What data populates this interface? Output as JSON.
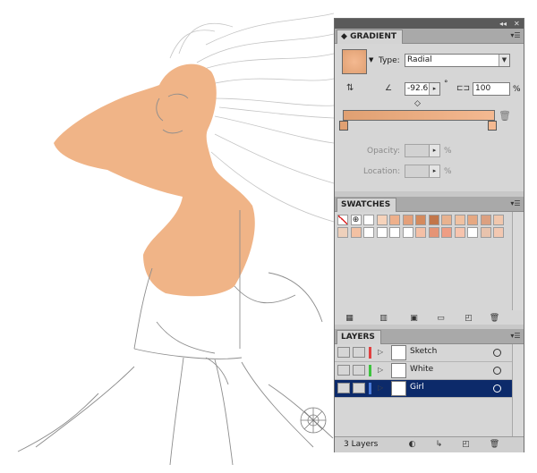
{
  "panel": {
    "collapse_icon": "double-arrow-icon",
    "close_icon": "close-icon"
  },
  "gradient": {
    "tab": "GRADIENT",
    "type_label": "Type:",
    "type_value": "Radial",
    "angle_value": "-92.6",
    "degree_symbol": "°",
    "aspect_value": "100",
    "percent_symbol": "%",
    "start_color": "#e0a072",
    "end_color": "#f4b991",
    "opacity_label": "Opacity:",
    "location_label": "Location:"
  },
  "swatches": {
    "tab": "SWATCHES",
    "row1": [
      "none",
      "registration",
      "#ffffff",
      "#f6d3bb",
      "#eeb08b",
      "#e4a07a",
      "#d48a5d",
      "#c2764a",
      "#e8b28f",
      "#f0c1a1",
      "#e6a882",
      "#dca080",
      "#f1c7ad"
    ],
    "row2": [
      "#eed0bb",
      "#f3c1a3",
      "#ffffff",
      "#ffffff",
      "#ffffff",
      "#ffffff",
      "#f5c0a6",
      "#e59476",
      "#ee9d84",
      "#f7c4ae",
      "#ffffff",
      "#e8c3ad",
      "#f3c8b1"
    ]
  },
  "layers": {
    "tab": "LAYERS",
    "items": [
      {
        "name": "Sketch",
        "color": "#e04040",
        "selected": false
      },
      {
        "name": "White",
        "color": "#3ec33e",
        "selected": false
      },
      {
        "name": "Girl",
        "color": "#4a7ad8",
        "selected": true
      }
    ],
    "count": "3 Layers"
  },
  "colors": {
    "skin": "#f0b487",
    "pencil": "#b9b9b9",
    "selected_row": "#0c2a6a"
  }
}
